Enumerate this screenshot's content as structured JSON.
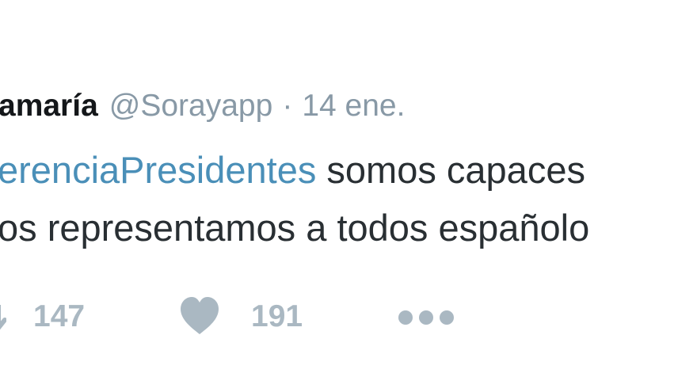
{
  "tweet": {
    "author_name": "amaría",
    "author_handle": "@Sorayapp",
    "separator": "·",
    "timestamp": "14 ene.",
    "hashtag": "erenciaPresidentes",
    "text_line1_rest": " somos capaces",
    "text_line2": "os representamos a todos españolo"
  },
  "actions": {
    "retweet_count": "147",
    "like_count": "191",
    "retweet_icon": "retweet-icon",
    "like_icon": "heart-icon",
    "more_icon": "more-dots-icon"
  },
  "colors": {
    "text": "#292f33",
    "muted": "#8899a6",
    "hashtag": "#4a8fb8",
    "action": "#aab8c2"
  }
}
